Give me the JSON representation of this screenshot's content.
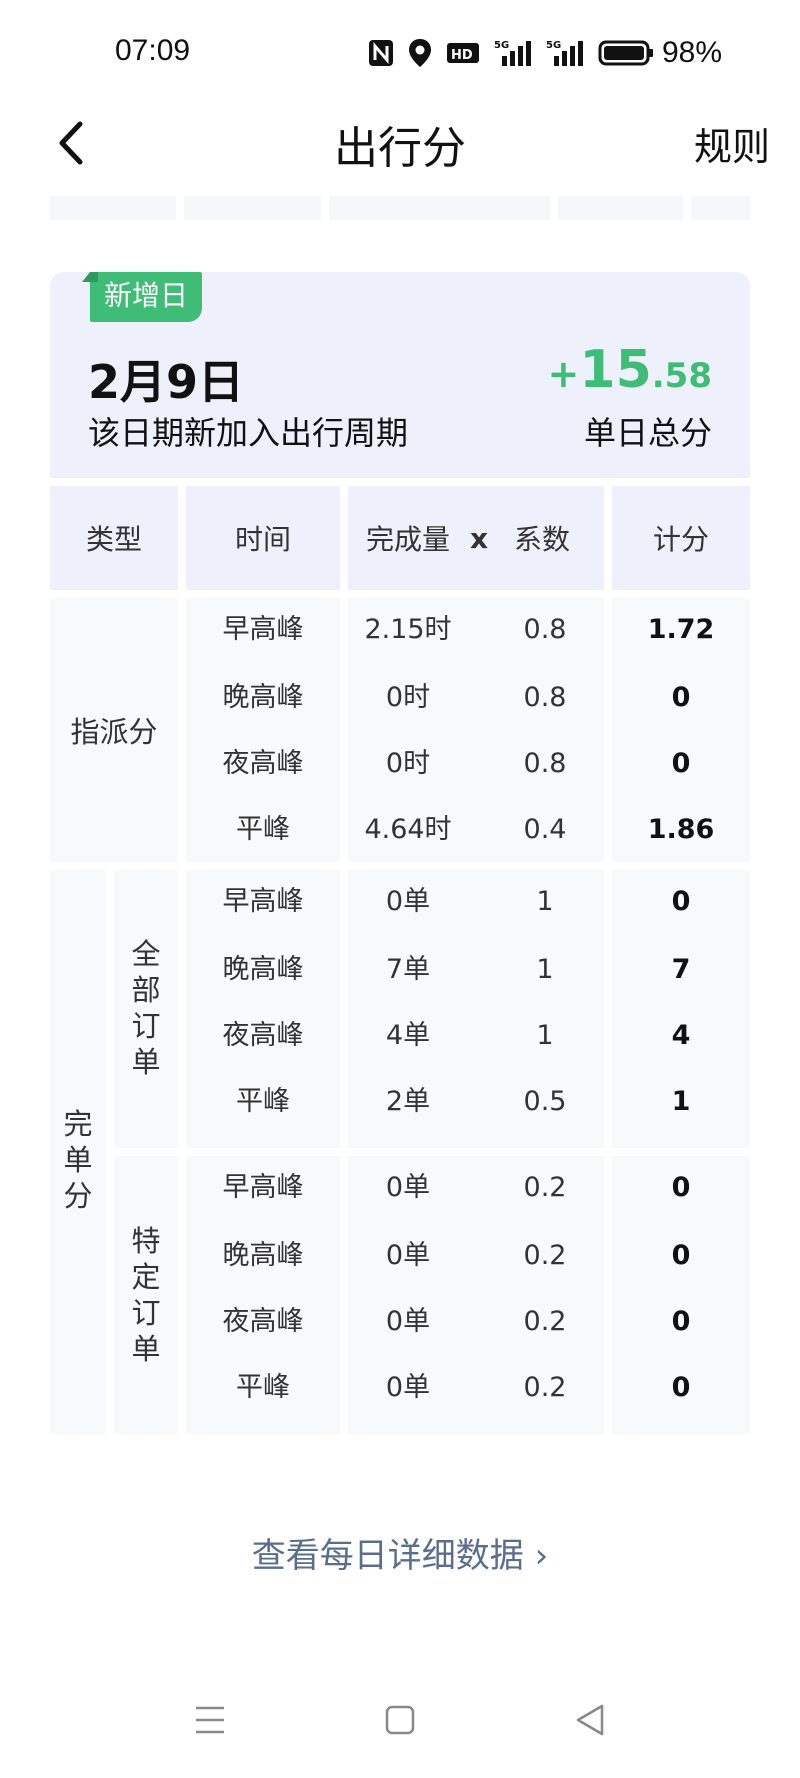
{
  "status": {
    "time": "07:09",
    "battery": "98%"
  },
  "header": {
    "title": "出行分",
    "rules": "规则"
  },
  "card": {
    "tag": "新增日",
    "date": "2月9日",
    "desc": "该日期新加入出行周期",
    "score_plus": "+",
    "score_int": "15",
    "score_dec": ".58",
    "score_label": "单日总分"
  },
  "table": {
    "headers": {
      "type": "类型",
      "time": "时间",
      "amount": "完成量",
      "x": "x",
      "coef": "系数",
      "score": "计分"
    },
    "groups": {
      "dispatch": "指派分",
      "complete": "完单分",
      "all_orders": "全部订单",
      "special_orders": "特定订单"
    },
    "rows": [
      {
        "time": "早高峰",
        "amount": "2.15时",
        "coef": "0.8",
        "score": "1.72"
      },
      {
        "time": "晚高峰",
        "amount": "0时",
        "coef": "0.8",
        "score": "0"
      },
      {
        "time": "夜高峰",
        "amount": "0时",
        "coef": "0.8",
        "score": "0"
      },
      {
        "time": "平峰",
        "amount": "4.64时",
        "coef": "0.4",
        "score": "1.86"
      },
      {
        "time": "早高峰",
        "amount": "0单",
        "coef": "1",
        "score": "0"
      },
      {
        "time": "晚高峰",
        "amount": "7单",
        "coef": "1",
        "score": "7"
      },
      {
        "time": "夜高峰",
        "amount": "4单",
        "coef": "1",
        "score": "4"
      },
      {
        "time": "平峰",
        "amount": "2单",
        "coef": "0.5",
        "score": "1"
      },
      {
        "time": "早高峰",
        "amount": "0单",
        "coef": "0.2",
        "score": "0"
      },
      {
        "time": "晚高峰",
        "amount": "0单",
        "coef": "0.2",
        "score": "0"
      },
      {
        "time": "夜高峰",
        "amount": "0单",
        "coef": "0.2",
        "score": "0"
      },
      {
        "time": "平峰",
        "amount": "0单",
        "coef": "0.2",
        "score": "0"
      }
    ]
  },
  "detail_link": "查看每日详细数据 ›",
  "colors": {
    "accent": "#3fbd76",
    "card_bg": "#eef1fb",
    "link": "#5a6e8c"
  }
}
